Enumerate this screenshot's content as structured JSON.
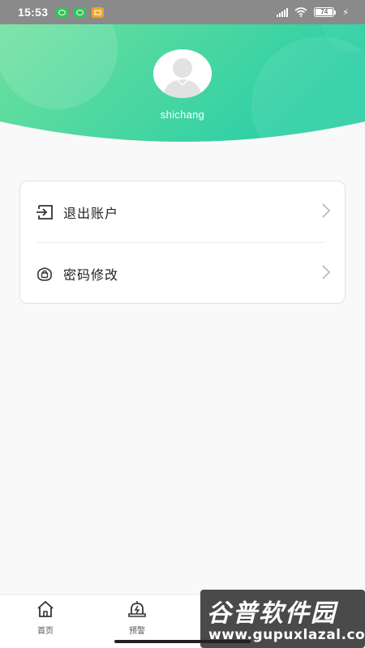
{
  "status_bar": {
    "time": "15:53",
    "notification_icons": [
      "wechat-icon",
      "wechat-icon",
      "message-icon"
    ],
    "battery_percent": "74"
  },
  "profile": {
    "username": "shichang",
    "header_gradient": [
      "#6ee0a0",
      "#2fcfa2"
    ]
  },
  "menu": {
    "items": [
      {
        "label": "退出账户",
        "icon": "logout-icon"
      },
      {
        "label": "密码修改",
        "icon": "lock-icon"
      }
    ]
  },
  "tabbar": {
    "tabs": [
      {
        "label": "首页",
        "icon": "home-icon"
      },
      {
        "label": "预警",
        "icon": "alarm-bell-icon"
      }
    ]
  },
  "watermark": {
    "title": "谷普软件园",
    "url": "www.gupuxlazal.com"
  }
}
